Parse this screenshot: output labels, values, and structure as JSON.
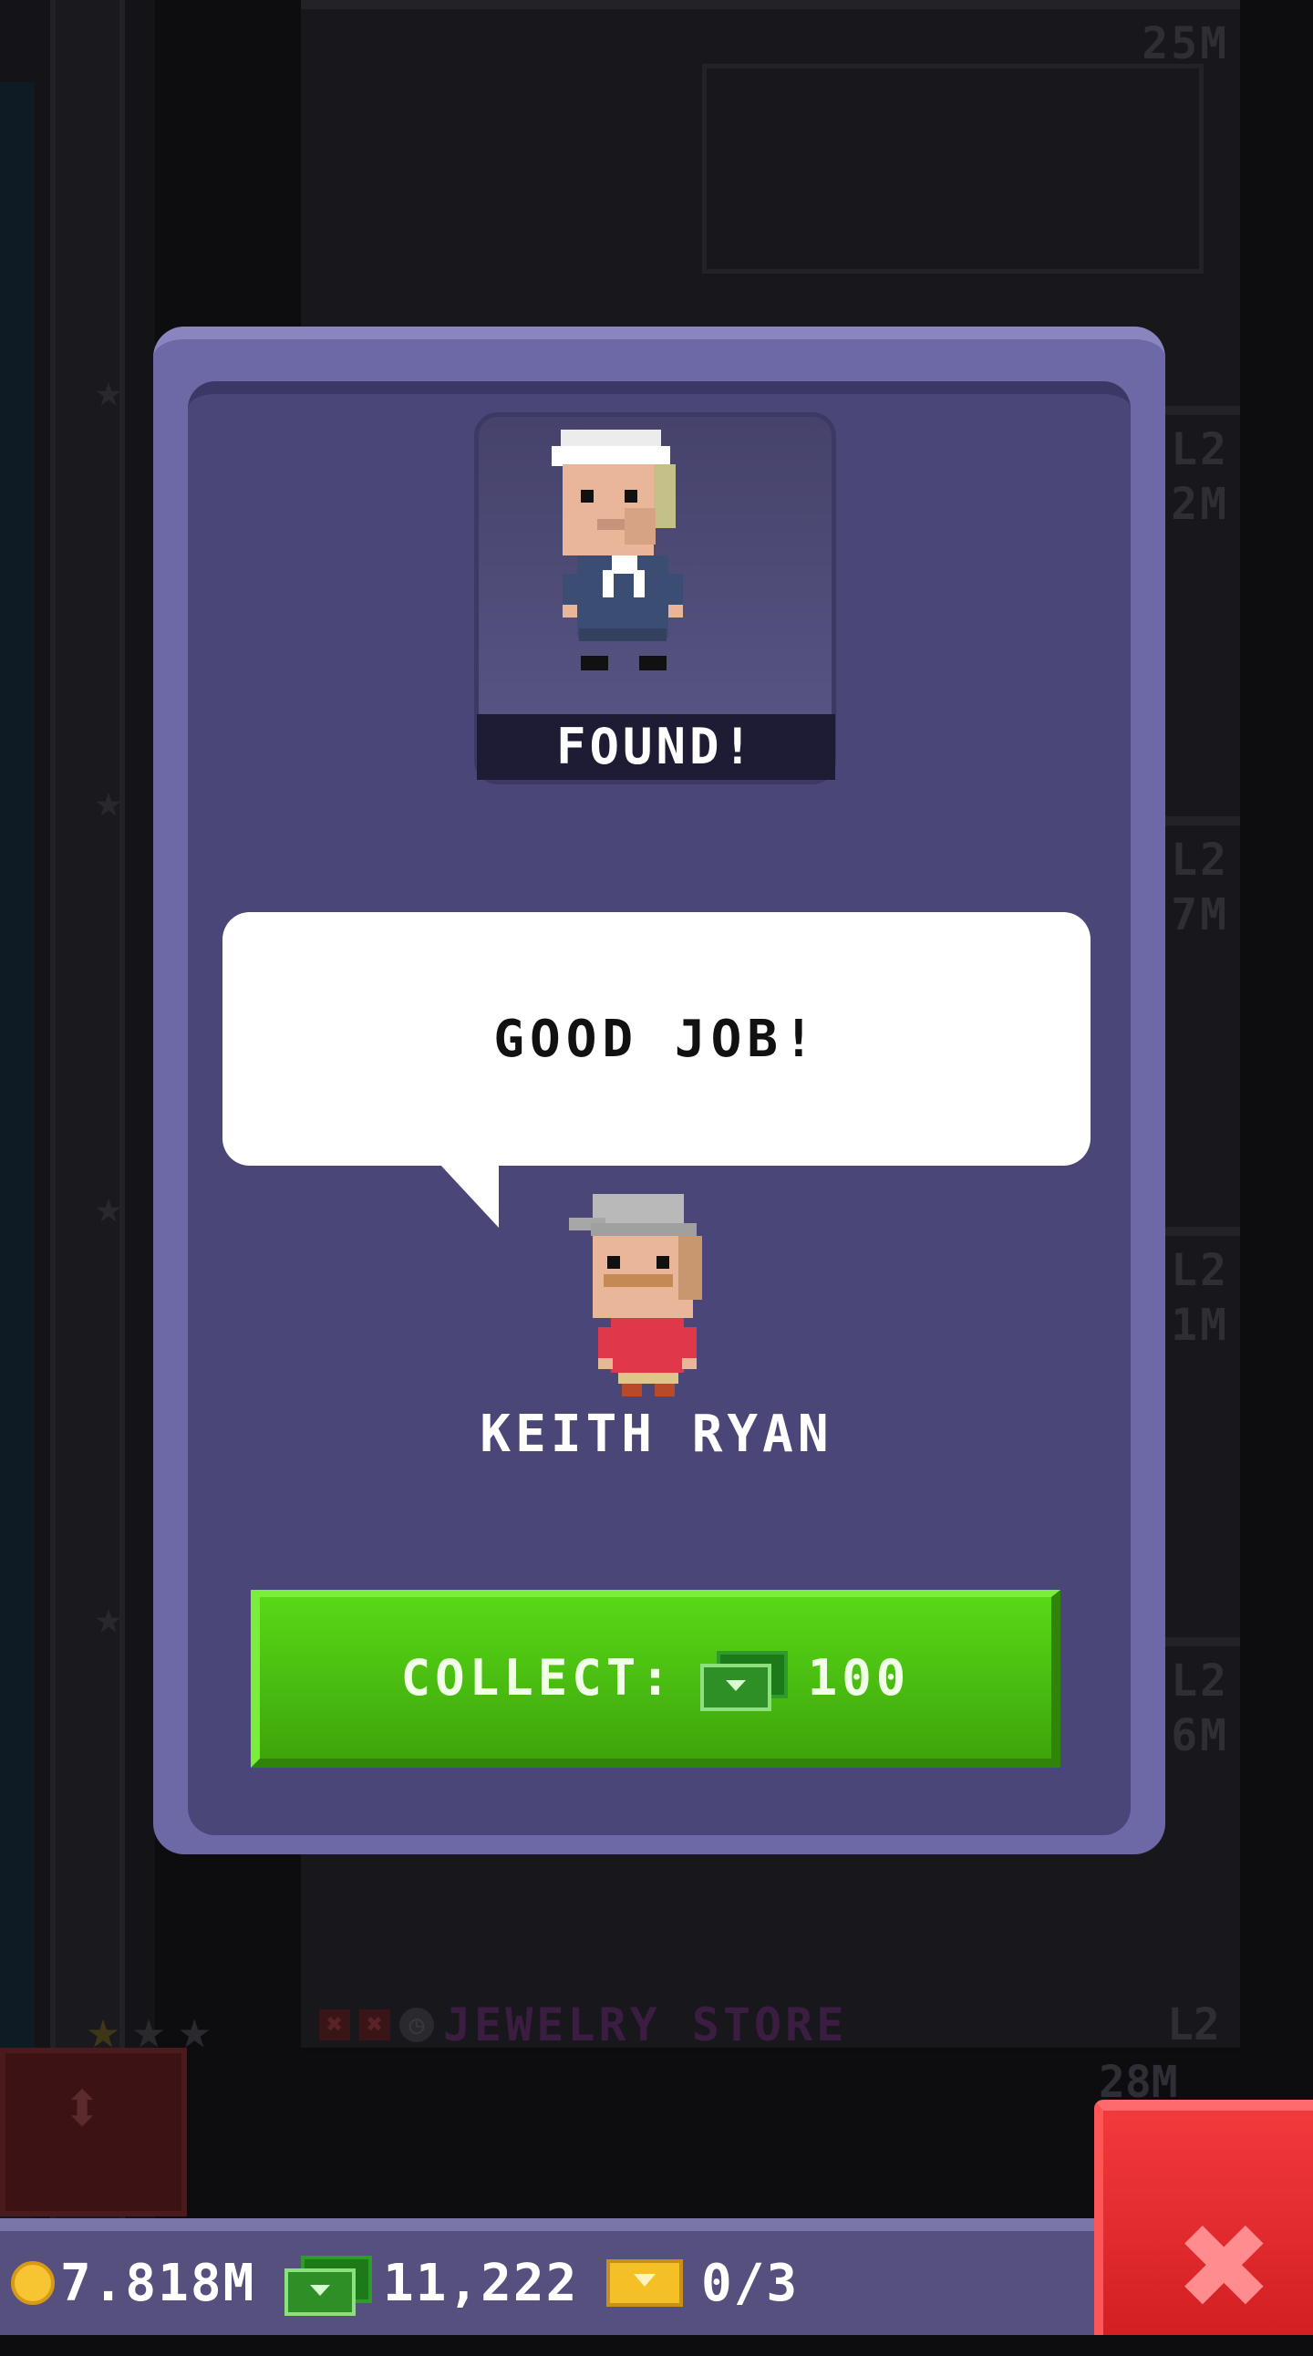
{
  "background": {
    "floors": [
      {
        "level": "",
        "population": "25M"
      },
      {
        "level": "L2",
        "population": "2M"
      },
      {
        "level": "L2",
        "population": "7M"
      },
      {
        "level": "L2",
        "population": "1M"
      },
      {
        "level": "L2",
        "population": "6M"
      }
    ],
    "jewelry_floor": {
      "name": "JEWELRY STORE",
      "level": "L2",
      "population": "28M"
    }
  },
  "modal": {
    "found_label": "FOUND!",
    "speech": "GOOD JOB!",
    "character_name": "KEITH RYAN",
    "collect": {
      "label": "COLLECT:",
      "amount": "100",
      "currency_icon": "bux-icon"
    }
  },
  "status": {
    "coins": "7.818M",
    "bux": "11,222",
    "tickets": "0/3"
  },
  "colors": {
    "panel": "#6d68a6",
    "panel_inner": "#4a4677",
    "collect_green": "#4cc212",
    "close_red": "#e22a2d"
  }
}
